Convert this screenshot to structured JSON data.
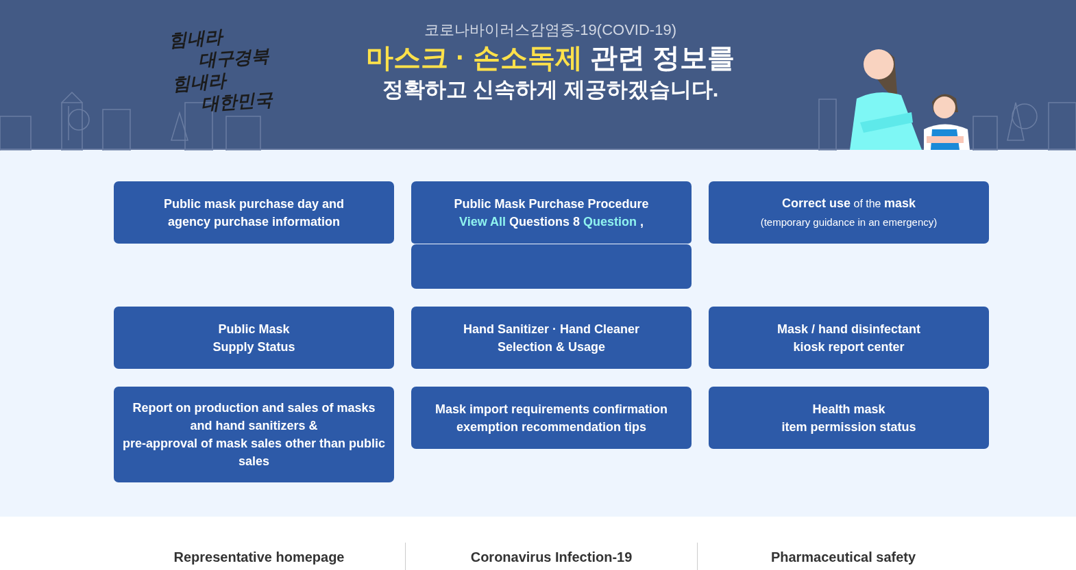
{
  "banner": {
    "calligraphy": [
      "힘내라",
      "대구경북",
      "힘내라",
      "대한민국"
    ],
    "subtitle": "코로나바이러스감염증-19(COVID-19)",
    "title": [
      {
        "text": "마스크 · 손소독제",
        "kind": "highlight"
      },
      {
        "text": " 관련 정보를",
        "kind": "plain"
      }
    ],
    "tagline": "정확하고 신속하게 제공하겠습니다."
  },
  "cards": [
    {
      "lines": [
        [
          {
            "text": "Public mask purchase day and",
            "kind": "plain"
          }
        ],
        [
          {
            "text": "agency purchase information",
            "kind": "plain"
          }
        ]
      ],
      "extra_panel": false
    },
    {
      "lines": [
        [
          {
            "text": "Public Mask Purchase Procedure",
            "kind": "plain"
          }
        ],
        [
          {
            "text": "View All",
            "kind": "highlight"
          },
          {
            "text": " Questions 8 ",
            "kind": "plain"
          },
          {
            "text": "Question",
            "kind": "highlight"
          },
          {
            "text": " ,",
            "kind": "plain"
          }
        ]
      ],
      "extra_panel": true
    },
    {
      "lines": [
        [
          {
            "text": "**Correct use** of the **mask**",
            "kind": "mixed"
          }
        ],
        [
          {
            "text": "(temporary guidance in an emergency)",
            "kind": "note"
          }
        ]
      ],
      "extra_panel": false
    },
    {
      "lines": [
        [
          {
            "text": "Public Mask",
            "kind": "plain"
          }
        ],
        [
          {
            "text": "Supply Status",
            "kind": "plain"
          }
        ]
      ],
      "extra_panel": false
    },
    {
      "lines": [
        [
          {
            "text": "Hand Sanitizer · Hand Cleaner",
            "kind": "plain"
          }
        ],
        [
          {
            "text": "Selection & Usage",
            "kind": "plain"
          }
        ]
      ],
      "extra_panel": false
    },
    {
      "lines": [
        [
          {
            "text": "Mask / hand disinfectant",
            "kind": "plain"
          }
        ],
        [
          {
            "text": "kiosk report center",
            "kind": "plain"
          }
        ]
      ],
      "extra_panel": false
    },
    {
      "lines": [
        [
          {
            "text": "Report on production and sales of masks",
            "kind": "plain"
          }
        ],
        [
          {
            "text": "and hand sanitizers &",
            "kind": "plain"
          }
        ],
        [
          {
            "text": "pre-approval of mask sales other than public",
            "kind": "plain"
          }
        ],
        [
          {
            "text": "sales",
            "kind": "plain"
          }
        ]
      ],
      "extra_panel": false
    },
    {
      "lines": [
        [
          {
            "text": "Mask import requirements confirmation",
            "kind": "plain"
          }
        ],
        [
          {
            "text": "exemption recommendation tips",
            "kind": "plain"
          }
        ]
      ],
      "extra_panel": false
    },
    {
      "lines": [
        [
          {
            "text": "Health mask",
            "kind": "plain"
          }
        ],
        [
          {
            "text": "item permission status",
            "kind": "plain"
          }
        ]
      ],
      "extra_panel": false
    }
  ],
  "footer": [
    "Representative homepage",
    "Coronavirus Infection-19",
    "Pharmaceutical safety"
  ]
}
